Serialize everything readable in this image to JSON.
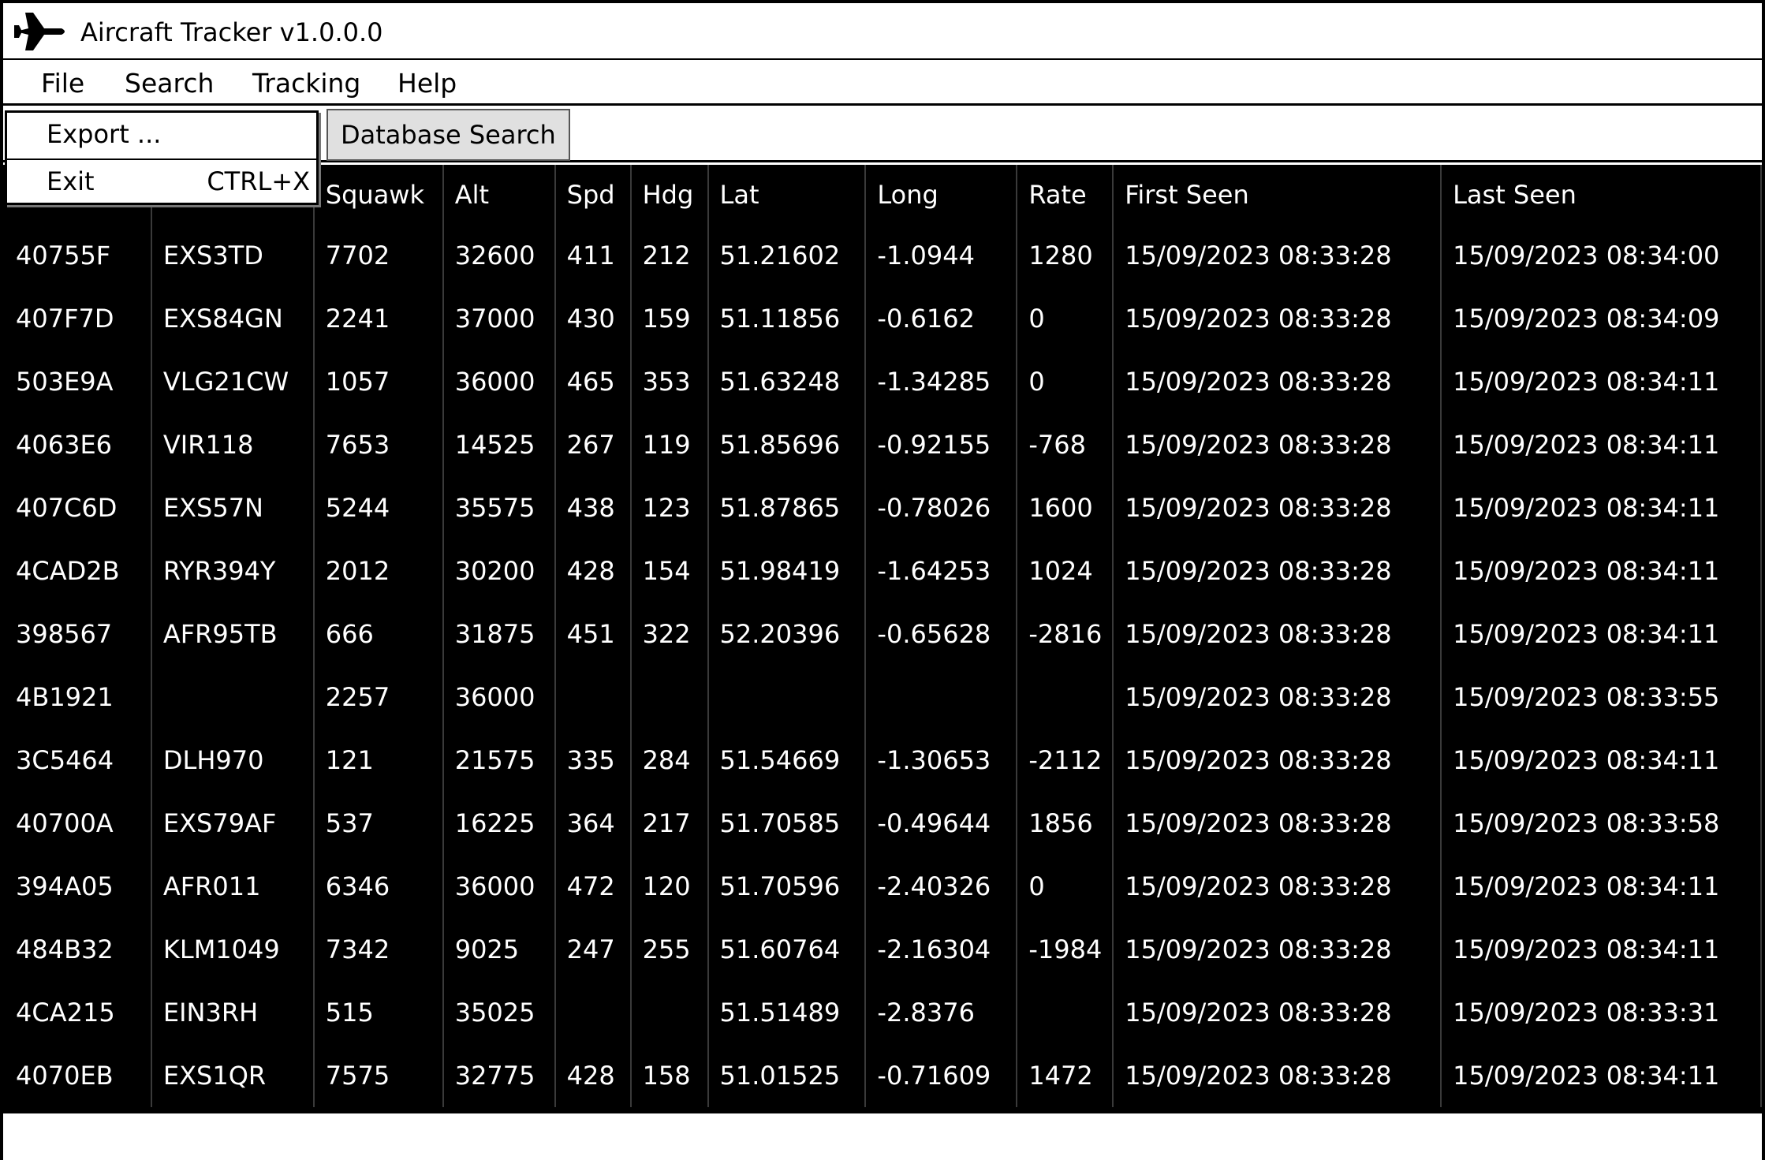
{
  "window": {
    "title": "Aircraft Tracker v1.0.0.0",
    "icon": "airplane-icon"
  },
  "menubar": {
    "items": [
      "File",
      "Search",
      "Tracking",
      "Help"
    ]
  },
  "file_menu": {
    "export_label": "Export ...",
    "exit_label": "Exit",
    "exit_shortcut": "CTRL+X"
  },
  "tabs": {
    "database_search_label": "Database Search"
  },
  "table": {
    "columns": [
      "",
      "",
      "Squawk",
      "Alt",
      "Spd",
      "Hdg",
      "Lat",
      "Long",
      "Rate",
      "First Seen",
      "Last Seen"
    ],
    "rows": [
      [
        "40755F",
        "EXS3TD",
        "7702",
        "32600",
        "411",
        "212",
        "51.21602",
        "-1.0944",
        "1280",
        "15/09/2023 08:33:28",
        "15/09/2023 08:34:00"
      ],
      [
        "407F7D",
        "EXS84GN",
        "2241",
        "37000",
        "430",
        "159",
        "51.11856",
        "-0.6162",
        "0",
        "15/09/2023 08:33:28",
        "15/09/2023 08:34:09"
      ],
      [
        "503E9A",
        "VLG21CW",
        "1057",
        "36000",
        "465",
        "353",
        "51.63248",
        "-1.34285",
        "0",
        "15/09/2023 08:33:28",
        "15/09/2023 08:34:11"
      ],
      [
        "4063E6",
        "VIR118",
        "7653",
        "14525",
        "267",
        "119",
        "51.85696",
        "-0.92155",
        "-768",
        "15/09/2023 08:33:28",
        "15/09/2023 08:34:11"
      ],
      [
        "407C6D",
        "EXS57N",
        "5244",
        "35575",
        "438",
        "123",
        "51.87865",
        "-0.78026",
        "1600",
        "15/09/2023 08:33:28",
        "15/09/2023 08:34:11"
      ],
      [
        "4CAD2B",
        "RYR394Y",
        "2012",
        "30200",
        "428",
        "154",
        "51.98419",
        "-1.64253",
        "1024",
        "15/09/2023 08:33:28",
        "15/09/2023 08:34:11"
      ],
      [
        "398567",
        "AFR95TB",
        "666",
        "31875",
        "451",
        "322",
        "52.20396",
        "-0.65628",
        "-2816",
        "15/09/2023 08:33:28",
        "15/09/2023 08:34:11"
      ],
      [
        "4B1921",
        "",
        "2257",
        "36000",
        "",
        "",
        "",
        "",
        "",
        "15/09/2023 08:33:28",
        "15/09/2023 08:33:55"
      ],
      [
        "3C5464",
        "DLH970",
        "121",
        "21575",
        "335",
        "284",
        "51.54669",
        "-1.30653",
        "-2112",
        "15/09/2023 08:33:28",
        "15/09/2023 08:34:11"
      ],
      [
        "40700A",
        "EXS79AF",
        "537",
        "16225",
        "364",
        "217",
        "51.70585",
        "-0.49644",
        "1856",
        "15/09/2023 08:33:28",
        "15/09/2023 08:33:58"
      ],
      [
        "394A05",
        "AFR011",
        "6346",
        "36000",
        "472",
        "120",
        "51.70596",
        "-2.40326",
        "0",
        "15/09/2023 08:33:28",
        "15/09/2023 08:34:11"
      ],
      [
        "484B32",
        "KLM1049",
        "7342",
        "9025",
        "247",
        "255",
        "51.60764",
        "-2.16304",
        "-1984",
        "15/09/2023 08:33:28",
        "15/09/2023 08:34:11"
      ],
      [
        "4CA215",
        "EIN3RH",
        "515",
        "35025",
        "",
        "",
        "51.51489",
        "-2.8376",
        "",
        "15/09/2023 08:33:28",
        "15/09/2023 08:33:31"
      ],
      [
        "4070EB",
        "EXS1QR",
        "7575",
        "32775",
        "428",
        "158",
        "51.01525",
        "-0.71609",
        "1472",
        "15/09/2023 08:33:28",
        "15/09/2023 08:34:11"
      ]
    ]
  },
  "statusbar": {
    "text": ""
  }
}
